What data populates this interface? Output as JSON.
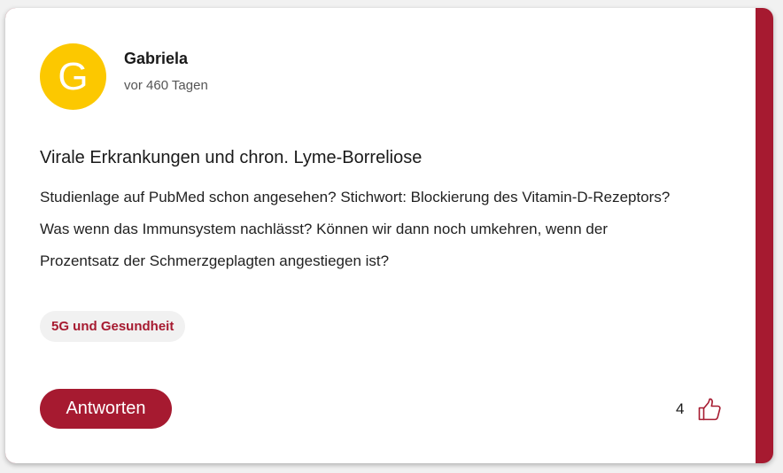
{
  "post": {
    "avatar_letter": "G",
    "author": "Gabriela",
    "timestamp": "vor 460 Tagen",
    "title": "Virale Erkrankungen und chron. Lyme-Borreliose",
    "body_lines": [
      "Studienlage auf PubMed schon angesehen? Stichwort: Blockierung des Vitamin-D-Rezeptors?",
      "Was wenn das Immunsystem nachlässt? Können wir dann noch umkehren, wenn der",
      "Prozentsatz der Schmerzgeplagten angestiegen ist?"
    ],
    "tag": "5G und Gesundheit",
    "reply_label": "Antworten",
    "like_count": "4",
    "like_icon": "thumbs-up-icon"
  },
  "colors": {
    "accent": "#a61a30",
    "avatar": "#fcc800",
    "tag_background": "#f1f1f1"
  }
}
